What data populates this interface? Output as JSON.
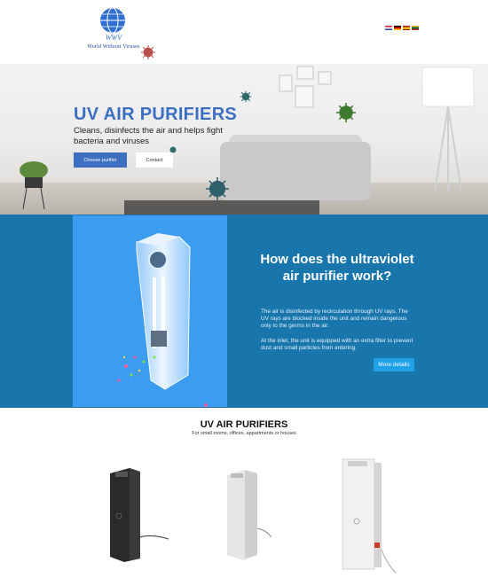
{
  "header": {
    "logo_text": "World Without Viruses",
    "logo_monogram": "WWV",
    "languages": [
      {
        "code": "en",
        "icon": "flag-en-icon"
      },
      {
        "code": "de",
        "icon": "flag-de-icon"
      },
      {
        "code": "es",
        "icon": "flag-es-icon"
      },
      {
        "code": "lt",
        "icon": "flag-lt-icon"
      }
    ]
  },
  "hero": {
    "title": "UV AIR PURIFIERS",
    "subtitle": "Cleans, disinfects the air and helps fight bacteria and viruses",
    "primary_button": "Choose purifier",
    "secondary_button": "Contact"
  },
  "info": {
    "title": "How does the ultraviolet air purifier work?",
    "paragraph1": "The air is disinfected by recirculation through UV rays. The UV rays are blocked inside the unit and remain dangerous only to the germs in the air.",
    "paragraph2": "At the inlet, the unit is equipped with an extra filter to prevent dust and small particles from entering.",
    "button": "More details"
  },
  "products": {
    "title": "UV AIR PURIFIERS",
    "subtitle": "For small rooms, offices, appartments or houses",
    "items": [
      {
        "color": "#2a2a2a",
        "name": "black-purifier"
      },
      {
        "color": "#e6e6e6",
        "name": "white-purifier"
      },
      {
        "color": "#f1f1f1",
        "name": "silver-purifier"
      }
    ]
  },
  "colors": {
    "accent": "#3d6fc0",
    "section_blue": "#1876ad",
    "button_blue": "#1fa1ea"
  }
}
